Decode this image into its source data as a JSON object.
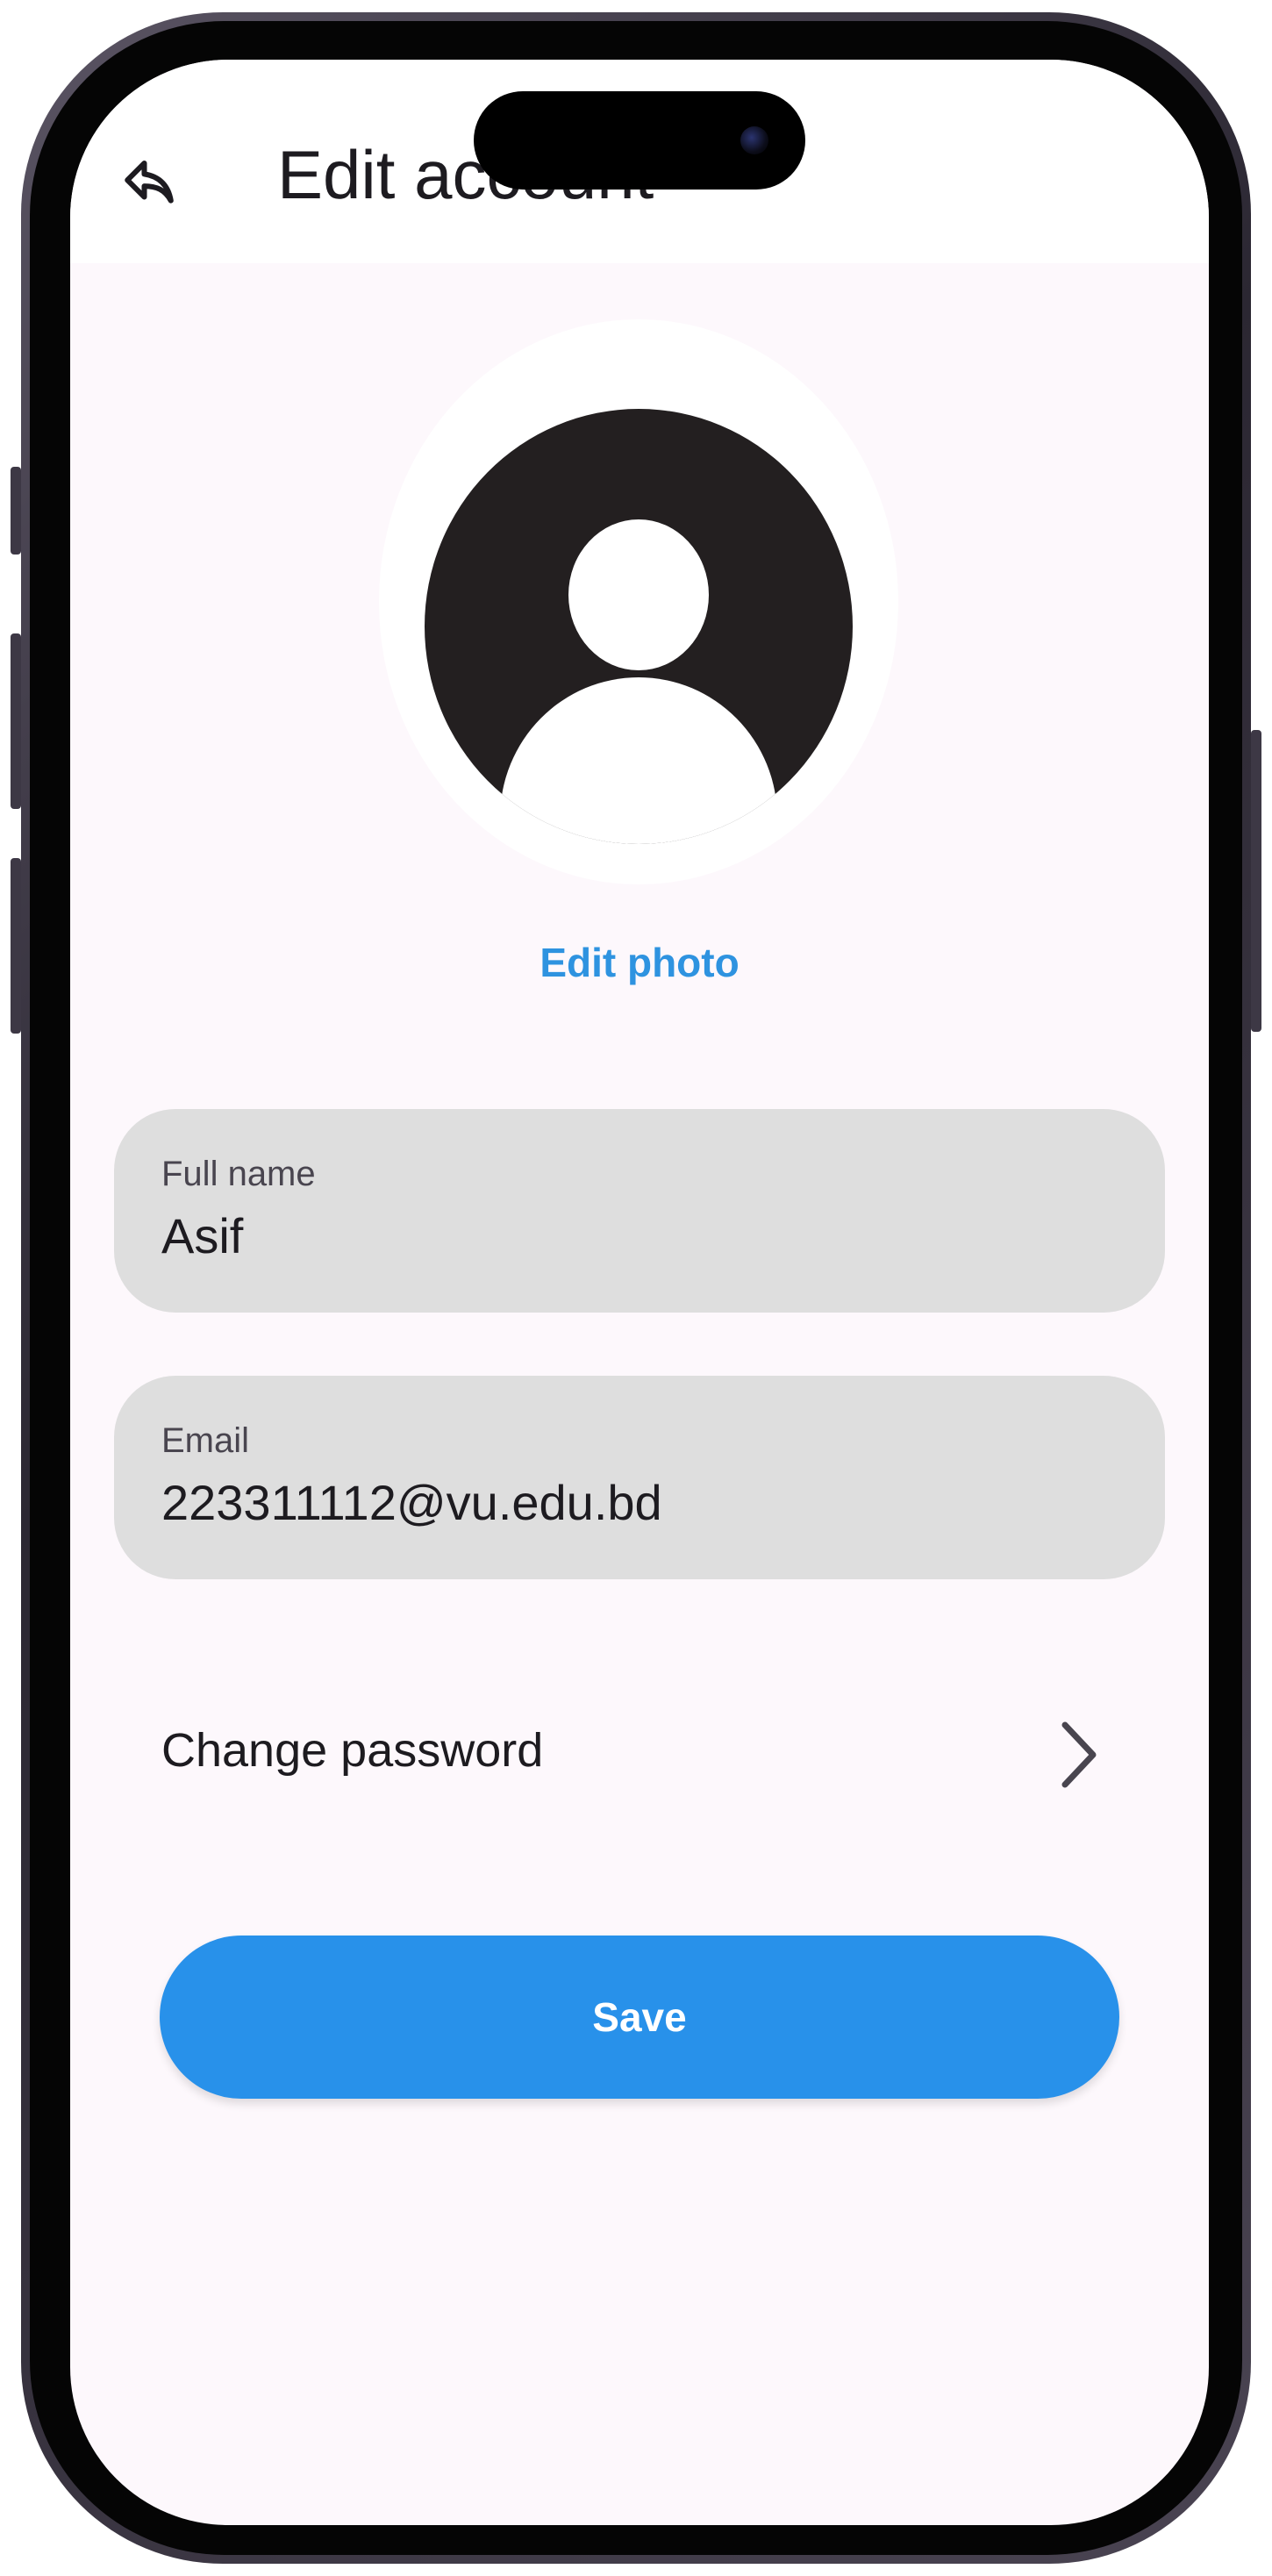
{
  "header": {
    "back_icon": "reply-back-icon",
    "title": "Edit account"
  },
  "profile": {
    "avatar_icon": "person-avatar-icon",
    "edit_photo_label": "Edit photo"
  },
  "form": {
    "full_name": {
      "label": "Full name",
      "value": "Asif"
    },
    "email": {
      "label": "Email",
      "value": "223311112@vu.edu.bd"
    }
  },
  "change_password": {
    "label": "Change password",
    "icon": "chevron-right-icon"
  },
  "save_button": {
    "label": "Save"
  },
  "colors": {
    "accent": "#2891ea",
    "link": "#2e93e0",
    "field_background": "#dedede",
    "screen_background": "#fdf8fc"
  }
}
